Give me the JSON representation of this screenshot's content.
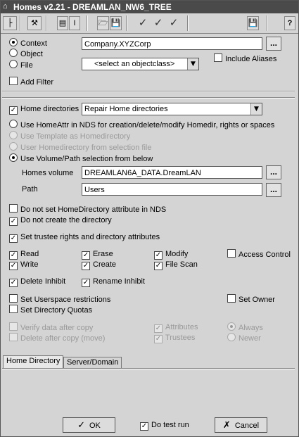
{
  "titlebar": {
    "title": "Homes v2.21 - DREAMLAN_NW6_TREE"
  },
  "toolbar": {
    "help_label": "?",
    "text_cursor": "I"
  },
  "context": {
    "context_label": "Context",
    "object_label": "Object",
    "file_label": "File",
    "context_value": "Company.XYZCorp",
    "objectclass_value": "<select an objectclass>",
    "include_aliases_label": "Include Aliases",
    "dots": "..."
  },
  "filter": {
    "add_filter_label": "Add Filter"
  },
  "homedirs": {
    "label": "Home directories",
    "mode_value": "Repair Home directories",
    "opt1": "Use HomeAttr in NDS for creation/delete/modify Homedir, rights or spaces",
    "opt2": "Use Template as Homedirectory",
    "opt3": "User Homedirectory from selection file",
    "opt4": "Use Volume/Path selection from below",
    "volume_label": "Homes volume",
    "volume_value": "DREAMLAN6A_DATA.DreamLAN",
    "path_label": "Path",
    "path_value": "Users"
  },
  "options": {
    "no_set_attr": "Do not set HomeDirectory attribute in NDS",
    "no_create": "Do not create the directory",
    "set_trustee": "Set trustee rights and directory attributes"
  },
  "rights": {
    "read": "Read",
    "erase": "Erase",
    "modify": "Modify",
    "access_control": "Access Control",
    "write": "Write",
    "create": "Create",
    "file_scan": "File Scan",
    "delete_inhibit": "Delete Inhibit",
    "rename_inhibit": "Rename Inhibit"
  },
  "space": {
    "userspace": "Set Userspace restrictions",
    "set_owner": "Set Owner",
    "quotas": "Set Directory Quotas"
  },
  "copy": {
    "verify": "Verify data after copy",
    "attributes": "Attributes",
    "always": "Always",
    "delete_after": "Delete after copy (move)",
    "trustees": "Trustees",
    "newer": "Newer"
  },
  "tabs": {
    "home": "Home Directory",
    "server": "Server/Domain"
  },
  "footer": {
    "ok": "OK",
    "test_run": "Do test run",
    "cancel": "Cancel",
    "check_mark": "✓",
    "x_mark": "✗"
  }
}
